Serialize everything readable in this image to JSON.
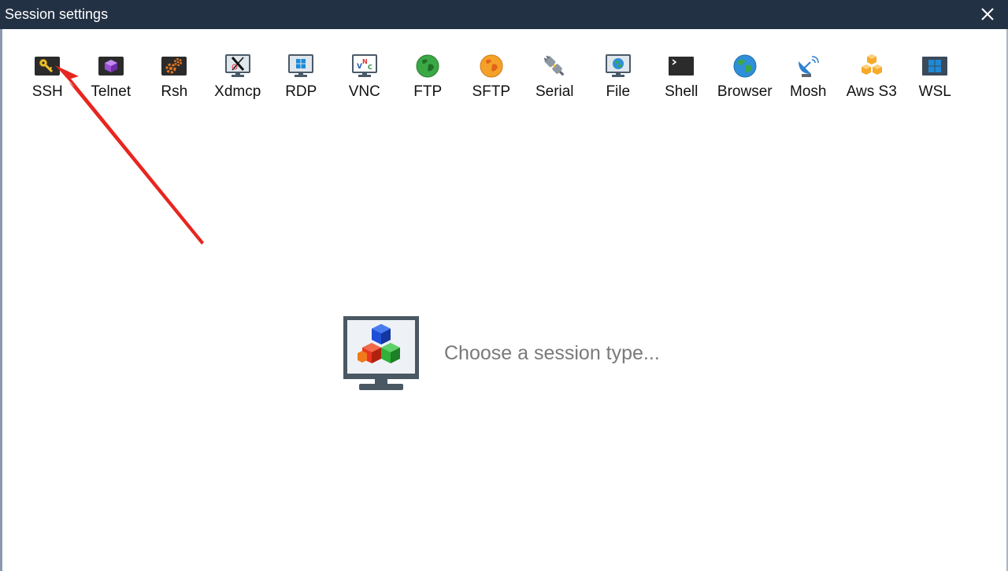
{
  "window": {
    "title": "Session settings"
  },
  "toolbar": {
    "items": [
      {
        "label": "SSH",
        "icon": "ssh-key-icon"
      },
      {
        "label": "Telnet",
        "icon": "telnet-icon"
      },
      {
        "label": "Rsh",
        "icon": "rsh-gears-icon"
      },
      {
        "label": "Xdmcp",
        "icon": "xdmcp-x-icon"
      },
      {
        "label": "RDP",
        "icon": "rdp-windows-icon"
      },
      {
        "label": "VNC",
        "icon": "vnc-icon"
      },
      {
        "label": "FTP",
        "icon": "ftp-globe-icon"
      },
      {
        "label": "SFTP",
        "icon": "sftp-globe-icon"
      },
      {
        "label": "Serial",
        "icon": "serial-plug-icon"
      },
      {
        "label": "File",
        "icon": "file-monitor-icon"
      },
      {
        "label": "Shell",
        "icon": "shell-terminal-icon"
      },
      {
        "label": "Browser",
        "icon": "browser-globe-icon"
      },
      {
        "label": "Mosh",
        "icon": "mosh-satellite-icon"
      },
      {
        "label": "Aws S3",
        "icon": "aws-s3-cubes-icon"
      },
      {
        "label": "WSL",
        "icon": "wsl-windows-icon"
      }
    ]
  },
  "main": {
    "placeholder_text": "Choose a session type..."
  },
  "colors": {
    "titlebar": "#233144",
    "annotation_arrow": "#e8251f",
    "placeholder_text": "#7a7a7a"
  }
}
